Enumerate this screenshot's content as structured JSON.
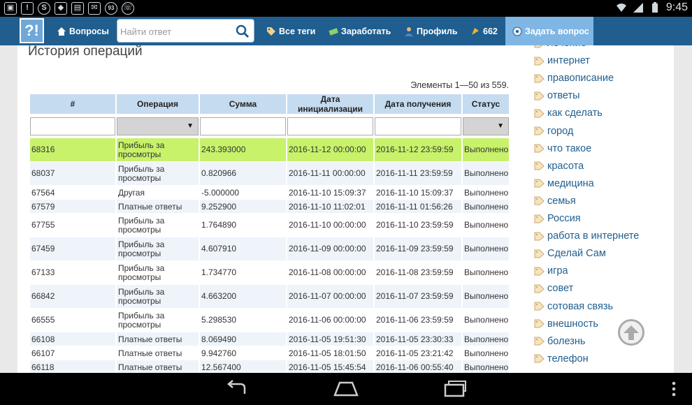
{
  "status_bar": {
    "time": "9:45",
    "notification_badge": "93"
  },
  "header": {
    "logo_text": "?!",
    "nav_questions": "Вопросы",
    "search_placeholder": "Найти ответ",
    "nav_all_tags": "Все теги",
    "nav_earn": "Заработать",
    "nav_profile": "Профиль",
    "points": "662",
    "ask_question": "Задать вопрос"
  },
  "main": {
    "title": "История операций",
    "pager_info": "Элементы 1—50 из 559.",
    "columns": [
      "#",
      "Операция",
      "Сумма",
      "Дата инициализации",
      "Дата получения",
      "Статус"
    ],
    "rows": [
      {
        "id": "68316",
        "op": "Прибыль за просмотры",
        "sum": "243.393000",
        "init": "2016-11-12 00:00:00",
        "recv": "2016-11-12 23:59:59",
        "status": "Выполнено",
        "highlight": true,
        "tall": true
      },
      {
        "id": "68037",
        "op": "Прибыль за просмотры",
        "sum": "0.820966",
        "init": "2016-11-11 00:00:00",
        "recv": "2016-11-11 23:59:59",
        "status": "Выполнено",
        "tall": true
      },
      {
        "id": "67564",
        "op": "Другая",
        "sum": "-5.000000",
        "init": "2016-11-10 15:09:37",
        "recv": "2016-11-10 15:09:37",
        "status": "Выполнено"
      },
      {
        "id": "67579",
        "op": "Платные ответы",
        "sum": "9.252900",
        "init": "2016-11-10 11:02:01",
        "recv": "2016-11-11 01:56:26",
        "status": "Выполнено"
      },
      {
        "id": "67755",
        "op": "Прибыль за просмотры",
        "sum": "1.764890",
        "init": "2016-11-10 00:00:00",
        "recv": "2016-11-10 23:59:59",
        "status": "Выполнено",
        "tall": true
      },
      {
        "id": "67459",
        "op": "Прибыль за просмотры",
        "sum": "4.607910",
        "init": "2016-11-09 00:00:00",
        "recv": "2016-11-09 23:59:59",
        "status": "Выполнено",
        "tall": true
      },
      {
        "id": "67133",
        "op": "Прибыль за просмотры",
        "sum": "1.734770",
        "init": "2016-11-08 00:00:00",
        "recv": "2016-11-08 23:59:59",
        "status": "Выполнено",
        "tall": true
      },
      {
        "id": "66842",
        "op": "Прибыль за просмотры",
        "sum": "4.663200",
        "init": "2016-11-07 00:00:00",
        "recv": "2016-11-07 23:59:59",
        "status": "Выполнено",
        "tall": true
      },
      {
        "id": "66555",
        "op": "Прибыль за просмотры",
        "sum": "5.298530",
        "init": "2016-11-06 00:00:00",
        "recv": "2016-11-06 23:59:59",
        "status": "Выполнено",
        "tall": true
      },
      {
        "id": "66108",
        "op": "Платные ответы",
        "sum": "8.069490",
        "init": "2016-11-05 19:51:30",
        "recv": "2016-11-05 23:30:33",
        "status": "Выполнено"
      },
      {
        "id": "66107",
        "op": "Платные ответы",
        "sum": "9.942760",
        "init": "2016-11-05 18:01:50",
        "recv": "2016-11-05 23:21:42",
        "status": "Выполнено"
      },
      {
        "id": "66118",
        "op": "Платные ответы",
        "sum": "12.567400",
        "init": "2016-11-05 15:45:54",
        "recv": "2016-11-06 00:55:40",
        "status": "Выполнено"
      }
    ]
  },
  "sidebar": {
    "tags": [
      "лечение",
      "интернет",
      "правописание",
      "ответы",
      "как сделать",
      "город",
      "что такое",
      "красота",
      "медицина",
      "семья",
      "Россия",
      "работа в интернете",
      "Сделай Сам",
      "игра",
      "совет",
      "сотовая связь",
      "внешность",
      "болезнь",
      "телефон"
    ]
  },
  "colors": {
    "header_bg": "#1f5e8f",
    "ask_bg": "#7fb6e4",
    "row_highlight": "#c7f26a",
    "th_bg": "#c5dbf0",
    "tag_link": "#1f5e8f"
  }
}
